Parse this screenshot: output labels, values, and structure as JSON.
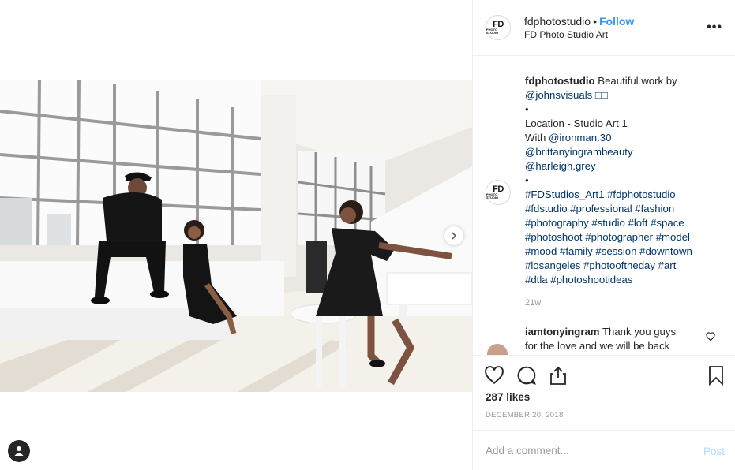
{
  "header": {
    "username": "fdphotostudio",
    "separator": "•",
    "follow_label": "Follow",
    "location": "FD Photo Studio Art",
    "more_label": "•••",
    "logo_text": "FD",
    "logo_subtext": "PHOTO STUDIO"
  },
  "caption": {
    "author": "fdphotostudio",
    "lines": [
      " Beautiful work by",
      "@johnsvisuals □□",
      "•",
      "Location - Studio Art 1",
      "With ",
      "@ironman.30",
      "@brittanyingrambeauty",
      "@harleigh.grey",
      "•",
      "#FDStudios_Art1 #fdphotostudio",
      "#fdstudio #professional #fashion",
      "#photography #studio #loft #space",
      "#photoshoot #photographer #model",
      "#mood #family #session #downtown",
      "#losangeles #photooftheday #art",
      "#dtla #photoshootideas"
    ],
    "time_ago": "21w"
  },
  "reply": {
    "author": "iamtonyingram",
    "text_line1": " Thank you guys",
    "text_line2": "for the love and we will be back"
  },
  "engagement": {
    "likes": "287 likes",
    "date": "DECEMBER 20, 2018"
  },
  "comment_box": {
    "placeholder": "Add a comment...",
    "post_label": "Post"
  },
  "colors": {
    "accent": "#3897f0",
    "link": "#003569",
    "muted": "#999999",
    "post_disabled": "#b3dbff"
  },
  "icons": [
    "chevron-right-icon",
    "user-tag-icon",
    "heart-icon",
    "comment-icon",
    "share-icon",
    "bookmark-icon",
    "more-icon"
  ]
}
